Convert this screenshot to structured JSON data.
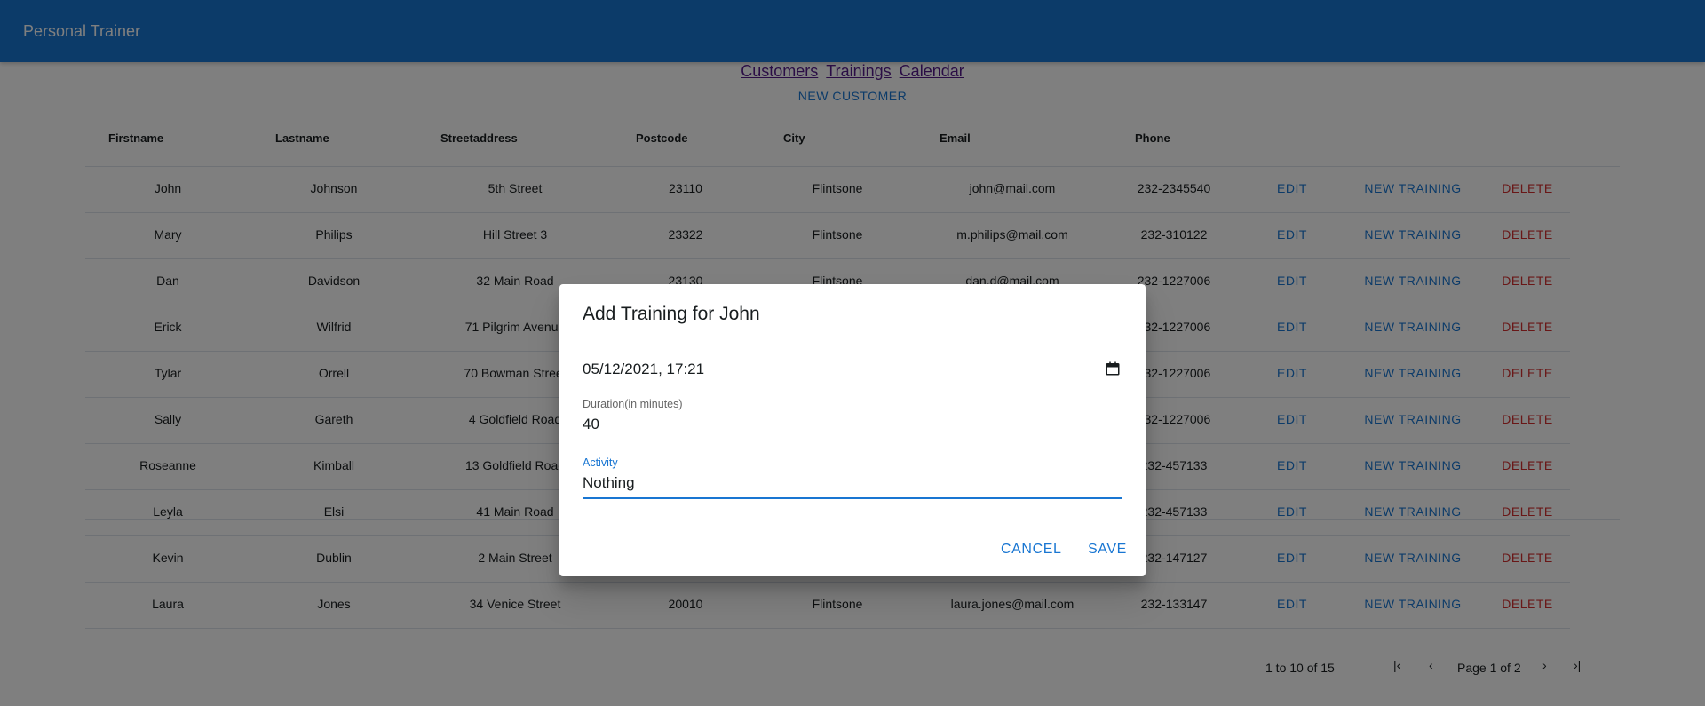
{
  "app": {
    "title": "Personal Trainer"
  },
  "nav": {
    "customers": "Customers",
    "trainings": "Trainings",
    "calendar": "Calendar"
  },
  "new_customer_label": "NEW CUSTOMER",
  "table": {
    "headers": [
      "Firstname",
      "Lastname",
      "Streetaddress",
      "Postcode",
      "City",
      "Email",
      "Phone"
    ],
    "rows": [
      [
        "John",
        "Johnson",
        "5th Street",
        "23110",
        "Flintsone",
        "john@mail.com",
        "232-2345540"
      ],
      [
        "Mary",
        "Philips",
        "Hill Street 3",
        "23322",
        "Flintsone",
        "m.philips@mail.com",
        "232-310122"
      ],
      [
        "Dan",
        "Davidson",
        "32 Main Road",
        "23130",
        "Flintsone",
        "dan.d@mail.com",
        "232-1227006"
      ],
      [
        "Erick",
        "Wilfrid",
        "71 Pilgrim Avenue",
        "",
        "",
        "",
        "232-1227006"
      ],
      [
        "Tylar",
        "Orrell",
        "70 Bowman Street",
        "",
        "",
        "",
        "232-1227006"
      ],
      [
        "Sally",
        "Gareth",
        "4 Goldfield Road",
        "",
        "",
        "",
        "232-1227006"
      ],
      [
        "Roseanne",
        "Kimball",
        "13 Goldfield Road",
        "",
        "",
        "",
        "232-457133"
      ],
      [
        "Leyla",
        "Elsi",
        "41 Main Road",
        "",
        "",
        "",
        "232-457133"
      ],
      [
        "Kevin",
        "Dublin",
        "2 Main Street",
        "",
        "",
        "",
        "232-147127"
      ],
      [
        "Laura",
        "Jones",
        "34 Venice Street",
        "20010",
        "Flintsone",
        "laura.jones@mail.com",
        "232-133147"
      ]
    ],
    "actions": {
      "edit": "EDIT",
      "new_training": "NEW TRAINING",
      "delete": "DELETE"
    }
  },
  "pagination": {
    "summary": "1 to 10 of 15",
    "page": "Page 1 of 2"
  },
  "dialog": {
    "title": "Add Training for John",
    "date_value": "05/12/2021, 17:21",
    "duration_label": "Duration(in minutes)",
    "duration_value": "40",
    "activity_label": "Activity",
    "activity_value": "Nothing",
    "cancel": "CANCEL",
    "save": "SAVE"
  },
  "colors": {
    "primary": "#1976d2",
    "danger": "#d32f2f",
    "link_visited": "#551a8b"
  },
  "icons": [
    "calendar-icon",
    "first-page-icon",
    "previous-page-icon",
    "next-page-icon",
    "last-page-icon"
  ]
}
